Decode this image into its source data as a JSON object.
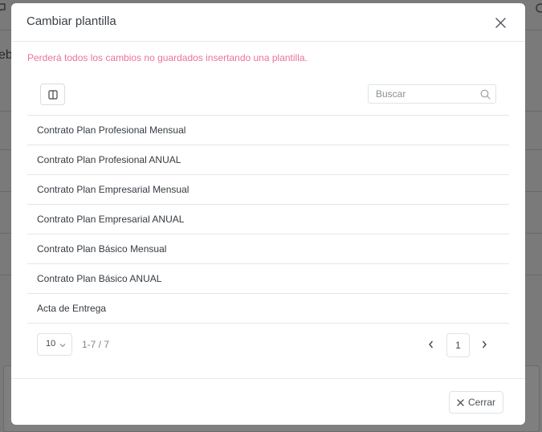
{
  "background": {
    "left_fragment": "eb",
    "icon_left": "chat-icon",
    "icon_right": "circle-icon"
  },
  "modal": {
    "title": "Cambiar plantilla",
    "warning": "Perderá todos los cambios no guardados insertando una plantilla.",
    "search_placeholder": "Buscar",
    "templates": [
      "Contrato Plan Profesional Mensual",
      "Contrato Plan Profesional ANUAL",
      "Contrato Plan Empresarial Mensual",
      "Contrato Plan Empresarial ANUAL",
      "Contrato Plan Básico Mensual",
      "Contrato Plan Básico ANUAL",
      "Acta de Entrega"
    ],
    "pagination": {
      "page_size": "10",
      "range": "1-7 / 7",
      "current_page": "1"
    },
    "close_label": "Cerrar"
  },
  "colors": {
    "warning": "#e8749a",
    "overlay": "rgba(0,0,0,0.5)"
  }
}
